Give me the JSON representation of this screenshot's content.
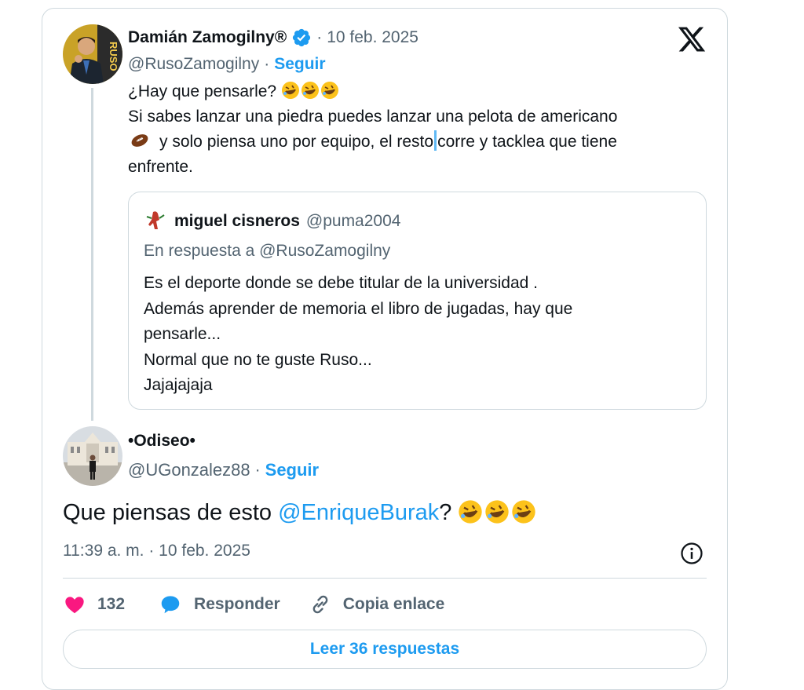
{
  "parent_tweet": {
    "name": "Damián Zamogilny®",
    "date": "10 feb. 2025",
    "separator": "·",
    "handle": "@RusoZamogilny",
    "follow_label": "Seguir",
    "text_lines": [
      "¿Hay que pensarle?",
      "Si sabes lanzar una piedra puedes lanzar una pelota de americano",
      "y solo piensa uno por equipo, el resto",
      "corre y tacklea que tiene",
      "enfrente."
    ],
    "avatar_text": "RUSO"
  },
  "quoted_tweet": {
    "name": "miguel cisneros",
    "handle": "@puma2004",
    "reply_context": "En respuesta a @RusoZamogilny",
    "text_lines": [
      "Es el deporte donde se debe titular de la universidad .",
      "Además aprender de memoria el libro de jugadas, hay que",
      "pensarle...",
      "Normal que no te guste Ruso...",
      "Jajajajaja"
    ]
  },
  "main_tweet": {
    "name": "•Odiseo•",
    "handle": "@UGonzalez88",
    "separator": "·",
    "follow_label": "Seguir",
    "text_before": "Que piensas de esto ",
    "mention": "@EnriqueBurak",
    "text_after": "?",
    "timestamp": "11:39 a. m. · 10 feb. 2025"
  },
  "actions": {
    "like_count": "132",
    "reply_label": "Responder",
    "copy_link_label": "Copia enlace"
  },
  "read_replies_label": "Leer 36 respuestas",
  "colors": {
    "accent": "#1d9bf0",
    "like": "#f91880",
    "border": "#cfd9de",
    "secondary_text": "#536471",
    "primary_text": "#0f1419"
  }
}
